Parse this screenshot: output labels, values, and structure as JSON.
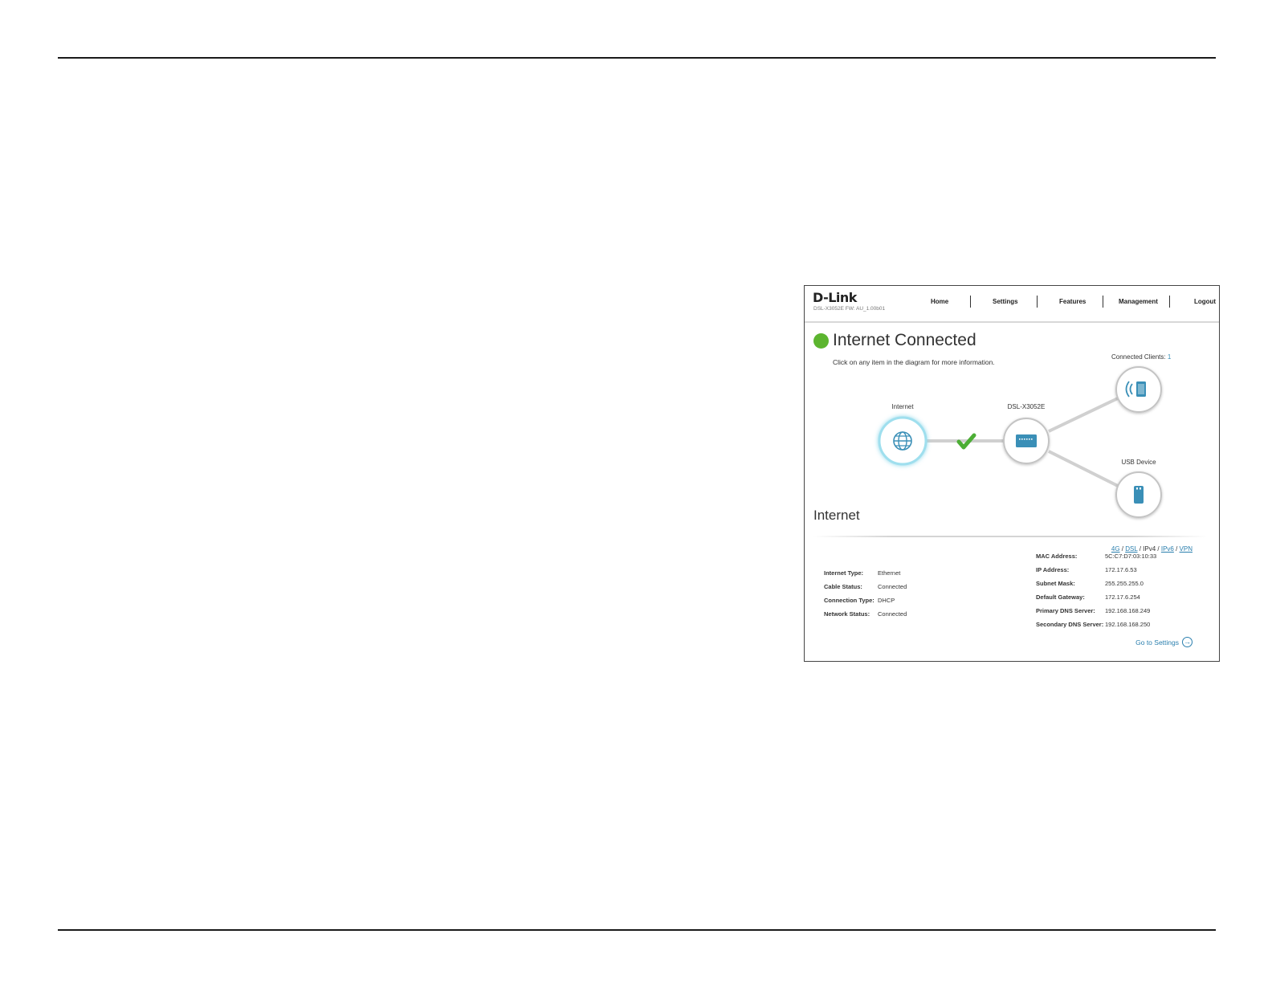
{
  "header": {
    "brand": "D-Link",
    "firmware": "DSL-X3052E  FW: AU_1.00b01",
    "nav": [
      "Home",
      "Settings",
      "Features",
      "Management",
      "Logout"
    ]
  },
  "status": {
    "title": "Internet Connected",
    "hint": "Click on any item in the diagram for more information.",
    "color": "#5cb52f"
  },
  "diagram": {
    "connected_clients_label": "Connected Clients:",
    "connected_clients_count": "1",
    "internet_label": "Internet",
    "router_label": "DSL-X3052E",
    "usb_label": "USB Device",
    "accent_color": "#3a8fb7",
    "check_color": "#4cae35"
  },
  "section": {
    "title": "Internet",
    "protocols": [
      "4G",
      "DSL",
      "IPv4",
      "IPv6",
      "VPN"
    ],
    "active_protocol": "IPv4",
    "left": [
      {
        "key": "Internet Type:",
        "value": "Ethernet"
      },
      {
        "key": "Cable Status:",
        "value": "Connected"
      },
      {
        "key": "Connection Type:",
        "value": "DHCP"
      },
      {
        "key": "Network Status:",
        "value": "Connected"
      }
    ],
    "right": [
      {
        "key": "MAC Address:",
        "value": "5C:C7:D7:03:10:33"
      },
      {
        "key": "IP Address:",
        "value": "172.17.6.53"
      },
      {
        "key": "Subnet Mask:",
        "value": "255.255.255.0"
      },
      {
        "key": "Default Gateway:",
        "value": "172.17.6.254"
      },
      {
        "key": "Primary DNS Server:",
        "value": "192.168.168.249"
      },
      {
        "key": "Secondary DNS Server:",
        "value": "192.168.168.250"
      }
    ],
    "goto_label": "Go to Settings"
  }
}
